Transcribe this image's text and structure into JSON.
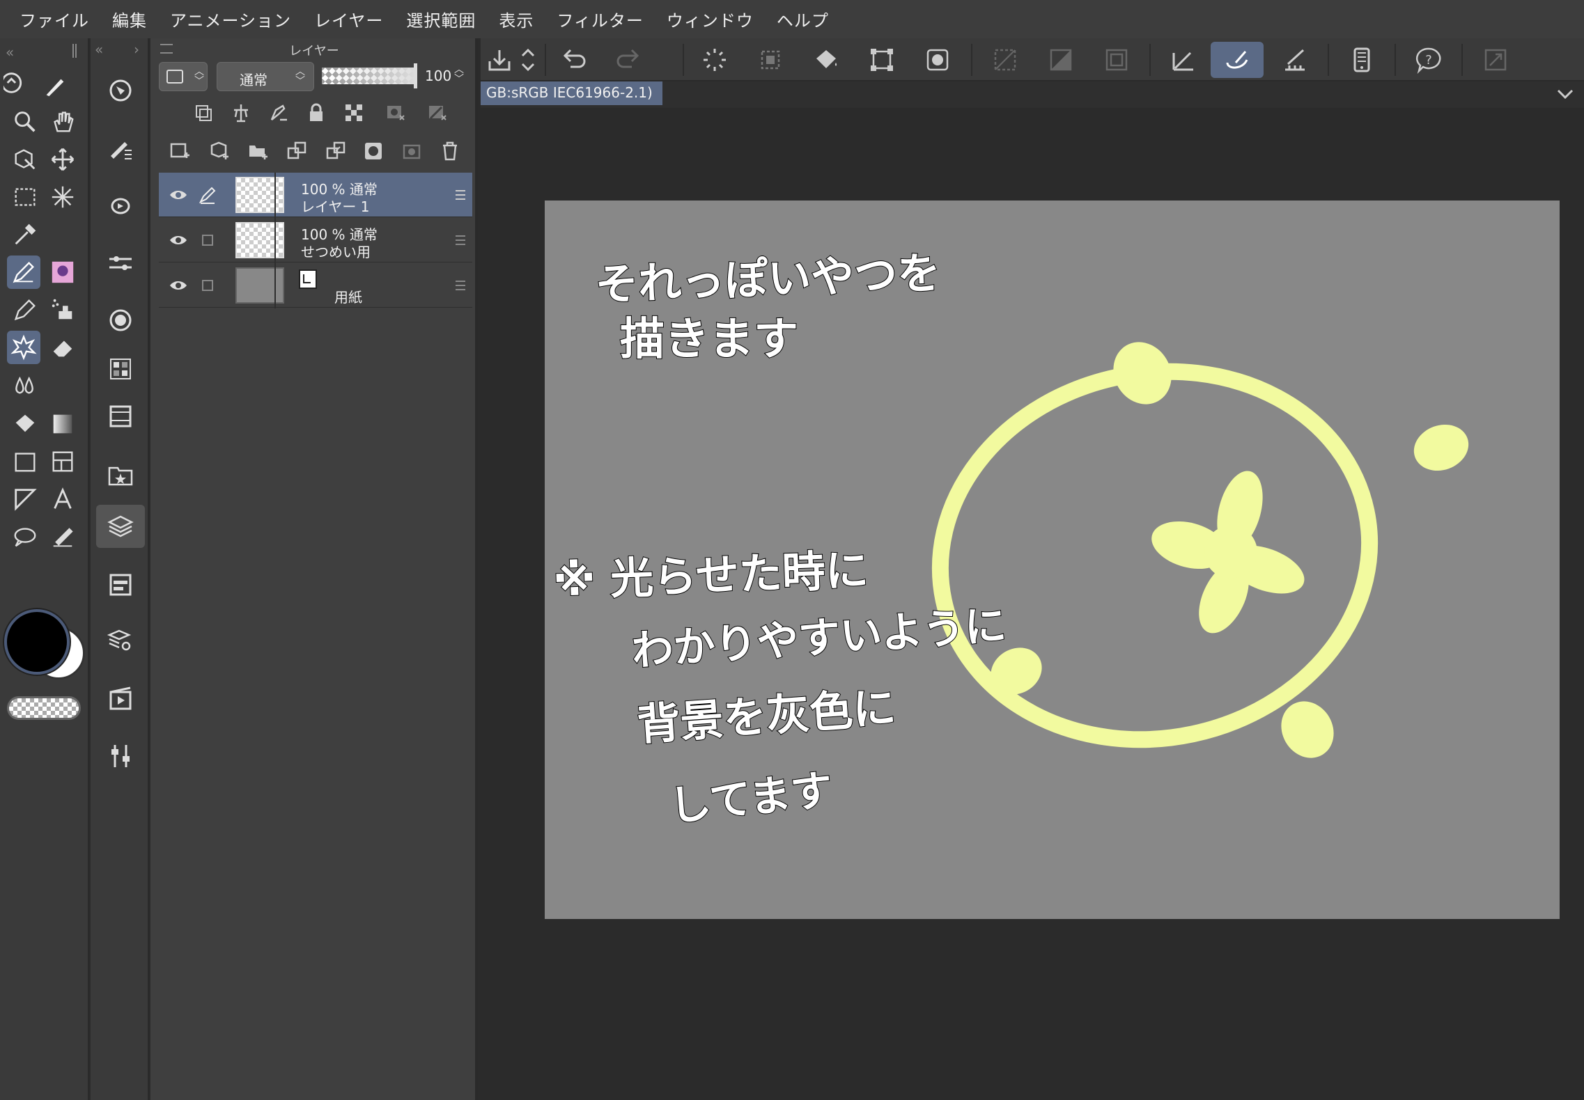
{
  "menu": [
    "ファイル",
    "編集",
    "アニメーション",
    "レイヤー",
    "選択範囲",
    "表示",
    "フィルター",
    "ウィンドウ",
    "ヘルプ"
  ],
  "layer_panel": {
    "title": "レイヤー",
    "blend_mode": "通常",
    "opacity": "100",
    "layers": [
      {
        "line1": "100 % 通常",
        "line2": "レイヤー 1",
        "selected": true
      },
      {
        "line1": "100 % 通常",
        "line2": "せつめい用",
        "selected": false
      },
      {
        "line1": "",
        "line2": "用紙",
        "selected": false
      }
    ]
  },
  "document_tab": "GB:sRGB IEC61966-2.1)",
  "canvas": {
    "background": "#888888",
    "drawing_color": "#f2fa9f",
    "handwriting": [
      "それっぽいやつを",
      "描きます",
      "※ 光らせた時に",
      "わかりやすいように",
      "背景を灰色に",
      "してます"
    ]
  },
  "colors": {
    "accent": "#5b6a86",
    "main_color": "#000000",
    "sub_color": "#ffffff"
  }
}
